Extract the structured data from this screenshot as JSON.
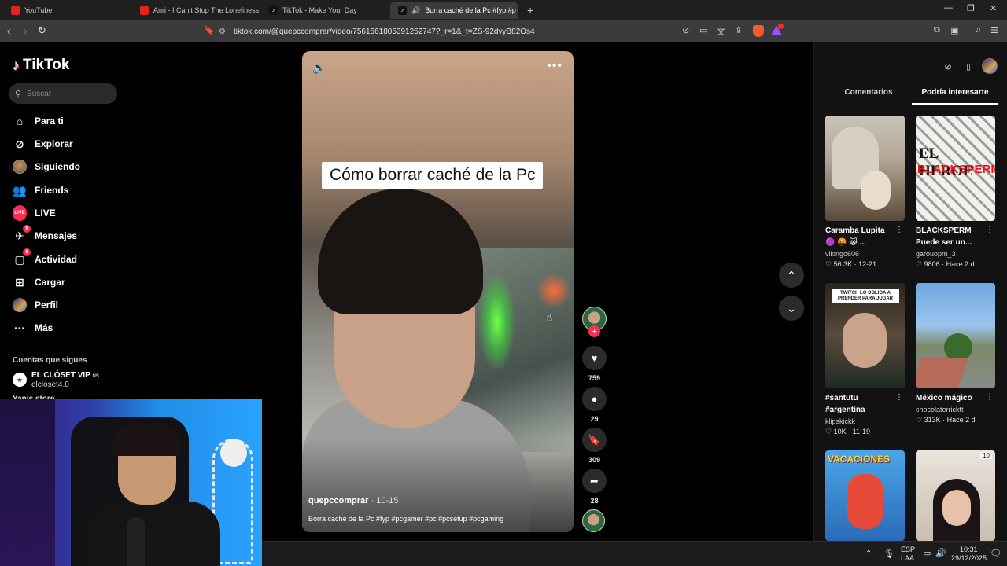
{
  "browser": {
    "tabs": [
      {
        "title": "YouTube",
        "favicon": "youtube-icon",
        "active": false
      },
      {
        "title": "Anri - I Can't Stop The Loneliness (Su",
        "favicon": "youtube-icon",
        "active": false
      },
      {
        "title": "TikTok - Make Your Day",
        "favicon": "tiktok-icon",
        "active": false
      },
      {
        "title": "Borra caché de la Pc #fyp #p",
        "favicon": "tiktok-icon",
        "active": true
      }
    ],
    "new_tab_label": "+",
    "url": "tiktok.com/@quepccomprar/video/7561561805391252747?_r=1&_t=ZS-92dvyB82Os4",
    "extension_badge": "1"
  },
  "sidebar": {
    "logo_text": "TikTok",
    "search_placeholder": "Buscar",
    "nav": [
      {
        "label": "Para ti",
        "icon": "home-icon"
      },
      {
        "label": "Explorar",
        "icon": "compass-icon"
      },
      {
        "label": "Siguiendo",
        "icon": "following-avatar-icon"
      },
      {
        "label": "Friends",
        "icon": "friends-icon"
      },
      {
        "label": "LIVE",
        "icon": "live-icon"
      },
      {
        "label": "Mensajes",
        "icon": "messages-icon",
        "badge": "9"
      },
      {
        "label": "Actividad",
        "icon": "activity-icon",
        "badge": "8"
      },
      {
        "label": "Cargar",
        "icon": "upload-icon"
      },
      {
        "label": "Perfil",
        "icon": "profile-avatar-icon"
      },
      {
        "label": "Más",
        "icon": "more-icon"
      }
    ],
    "following_title": "Cuentas que sigues",
    "following": [
      {
        "name": "EL CLÓSET VIP",
        "flag": "us",
        "handle": "elcloset4.0"
      },
      {
        "name": "Yanis store"
      }
    ]
  },
  "video": {
    "caption_overlay": "Cómo borrar caché de la Pc",
    "author": "quepccomprar",
    "date": "10-15",
    "separator": "·",
    "description": "Borra caché de la Pc #fyp #pcgamer #pc #pcsetup #pcgaming"
  },
  "actions": {
    "likes": "759",
    "comments": "29",
    "saves": "309",
    "shares": "28"
  },
  "right_panel": {
    "tabs": [
      {
        "label": "Comentarios",
        "active": false
      },
      {
        "label": "Podría interesarte",
        "active": true
      }
    ],
    "cards": [
      {
        "title": "Caramba Lupita",
        "title2": "🟣 🤬 😺 ...",
        "user": "vikingo606",
        "likes": "56.3K",
        "date": "12-21",
        "thumb_text": ""
      },
      {
        "title": "BLACKSPERM",
        "title2": "Puede ser un...",
        "user": "garouopm_3",
        "likes": "9806",
        "date": "Hace 2 d",
        "thumb_text": "EL HEROE",
        "thumb_text2": "BLACKSPERM"
      },
      {
        "title": "#santutu",
        "title2": "#argentina",
        "user": "klipskickk",
        "likes": "10K",
        "date": "11-19",
        "thumb_text": "TWITCH LO OBLIGA A PRENDER PARA JUGAR"
      },
      {
        "title": "México mágico",
        "title2": "",
        "user": "chocolaterricktt",
        "likes": "313K",
        "date": "Hace 2 d",
        "thumb_text": ""
      },
      {
        "title": "",
        "title2": "",
        "user": "",
        "likes": "",
        "date": "",
        "thumb_text": "VACACIONES"
      },
      {
        "title": "",
        "title2": "",
        "user": "",
        "likes": "",
        "date": "",
        "thumb_text": "10"
      }
    ]
  },
  "taskbar": {
    "lang": "ESP",
    "lang2": "LAA",
    "time": "10:31",
    "date": "29/12/2025"
  },
  "colors": {
    "accent": "#fe2c55",
    "background": "#000000",
    "panel": "#121212"
  }
}
